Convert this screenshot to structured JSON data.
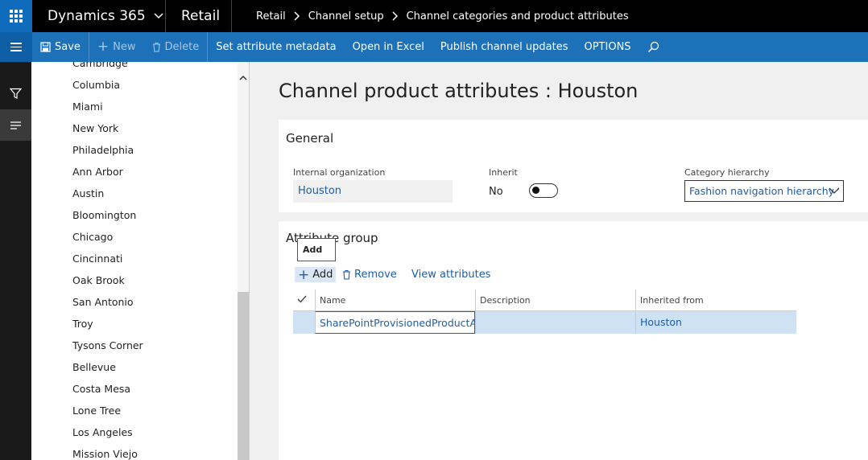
{
  "topbar": {
    "app_name": "Dynamics 365",
    "area": "Retail",
    "breadcrumbs": [
      "Retail",
      "Channel setup",
      "Channel categories and product attributes"
    ]
  },
  "actionbar": {
    "save": "Save",
    "new": "New",
    "delete": "Delete",
    "set_attribute_metadata": "Set attribute metadata",
    "open_in_excel": "Open in Excel",
    "publish": "Publish channel updates",
    "options": "OPTIONS"
  },
  "list": {
    "partial_top": "Cambridge",
    "items": [
      "Columbia",
      "Miami",
      "New York",
      "Philadelphia",
      "Ann Arbor",
      "Austin",
      "Bloomington",
      "Chicago",
      "Cincinnati",
      "Oak Brook",
      "San Antonio",
      "Troy",
      "Tysons Corner",
      "Bellevue",
      "Costa Mesa",
      "Lone Tree",
      "Los Angeles",
      "Mission Viejo"
    ]
  },
  "page": {
    "title": "Channel product attributes : Houston"
  },
  "general": {
    "title": "General",
    "internal_org_label": "Internal organization",
    "internal_org_value": "Houston",
    "inherit_label": "Inherit",
    "inherit_value": "No",
    "category_label": "Category hierarchy",
    "category_value": "Fashion navigation hierarchy"
  },
  "attribute_group": {
    "title": "Attribute group",
    "tooltip": "Add",
    "add": "Add",
    "remove": "Remove",
    "view_attributes": "View attributes",
    "columns": {
      "name": "Name",
      "description": "Description",
      "inherited_from": "Inherited from"
    },
    "rows": [
      {
        "name": "SharePointProvisionedProductAttributes",
        "description": "",
        "inherited_from": "Houston"
      }
    ]
  },
  "colors": {
    "accent": "#1d71b8",
    "link": "#1b5ea8",
    "selected_row": "#cfe2f3"
  }
}
